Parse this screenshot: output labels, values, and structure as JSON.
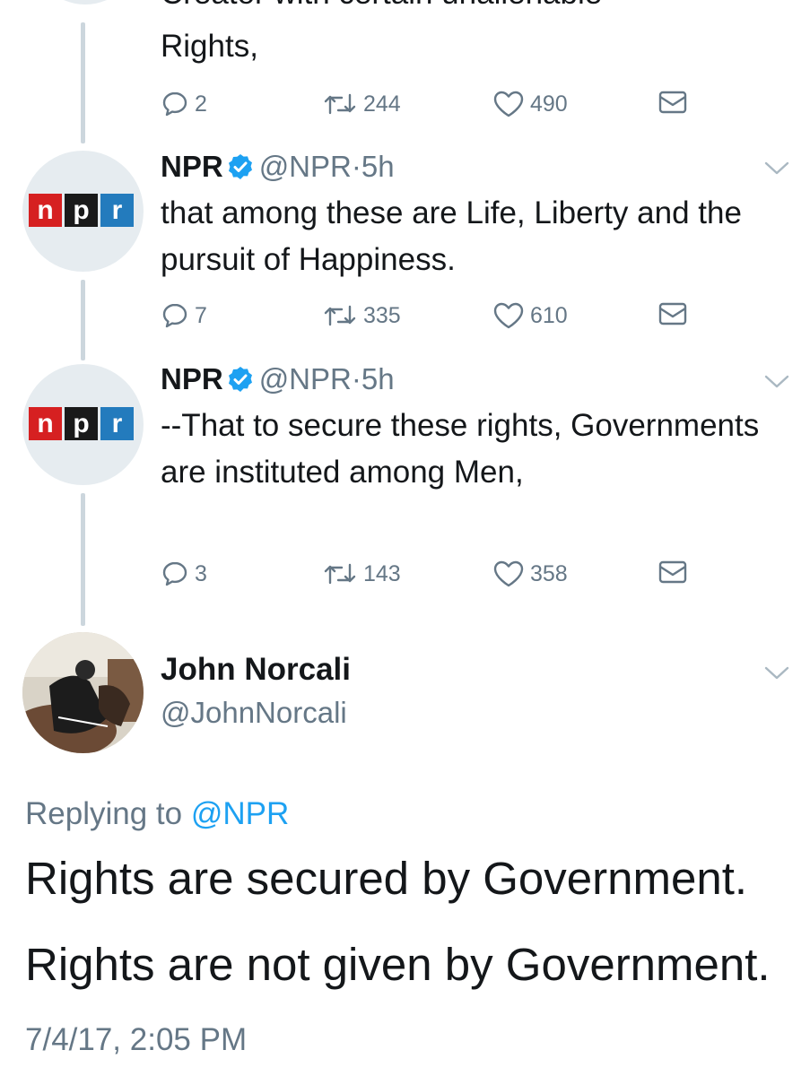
{
  "tweets": [
    {
      "text_line_cut": "Creator with certain unalienable",
      "text_line": "Rights,",
      "reply_count": "2",
      "retweet_count": "244",
      "like_count": "490"
    },
    {
      "name": "NPR",
      "handle": "@NPR",
      "time": "5h",
      "text": "that among these are Life, Liberty and the pursuit of Happiness.",
      "reply_count": "7",
      "retweet_count": "335",
      "like_count": "610"
    },
    {
      "name": "NPR",
      "handle": "@NPR",
      "time": "5h",
      "text": "--That to secure these rights, Governments are instituted among Men,",
      "reply_count": "3",
      "retweet_count": "143",
      "like_count": "358"
    }
  ],
  "npr_logo": {
    "n": "n",
    "p": "p",
    "r": "r"
  },
  "main_tweet": {
    "name": "John Norcali",
    "handle": "@JohnNorcali",
    "replying_label": "Replying to",
    "replying_to": "@NPR",
    "paragraph1": "Rights are secured by Government.",
    "paragraph2": "Rights are not given by Government.",
    "timestamp": "7/4/17, 2:05 PM"
  },
  "colors": {
    "verified": "#1da1f2",
    "link": "#1da1f2",
    "secondary_text": "#657786",
    "thread_line": "#ccd6dd",
    "npr_red": "#d62021",
    "npr_black": "#1a1a1a",
    "npr_blue": "#237bbd"
  },
  "icons": [
    "reply-icon",
    "retweet-icon",
    "like-icon",
    "direct-message-icon",
    "chevron-down-icon",
    "verified-badge-icon"
  ]
}
